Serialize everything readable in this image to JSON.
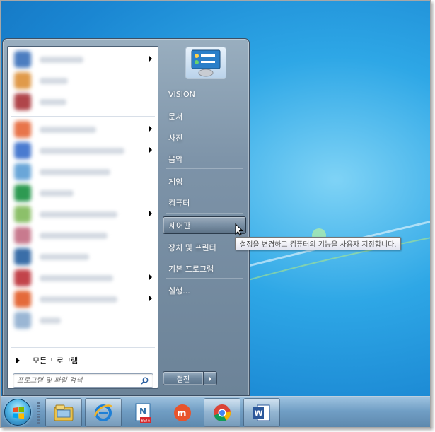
{
  "start_menu": {
    "right_items": [
      {
        "label": "VISION"
      },
      {
        "label": "문서"
      },
      {
        "label": "사진"
      },
      {
        "label": "음악"
      },
      {
        "label": "게임"
      },
      {
        "label": "컴퓨터"
      },
      {
        "label": "제어판"
      },
      {
        "label": "장치 및 프린터"
      },
      {
        "label": "기본 프로그램"
      },
      {
        "label": "실행..."
      }
    ],
    "all_programs_label": "모든 프로그램",
    "search_placeholder": "프로그램 및 파일 검색",
    "shutdown_label": "절전"
  },
  "tooltip": {
    "text": "설정을 변경하고 컴퓨터의 기능을 사용자 지정합니다."
  },
  "taskbar": {
    "pinned_icons": [
      "windows-explorer-icon",
      "internet-explorer-icon",
      "naver-note-icon",
      "meebo-icon",
      "chrome-icon",
      "word-icon"
    ],
    "note_badge": "BETA"
  },
  "colors": {
    "desktop": "#1a86d2",
    "start_menu_bg": "#7d93a8",
    "highlight": "#2c3c4c"
  }
}
